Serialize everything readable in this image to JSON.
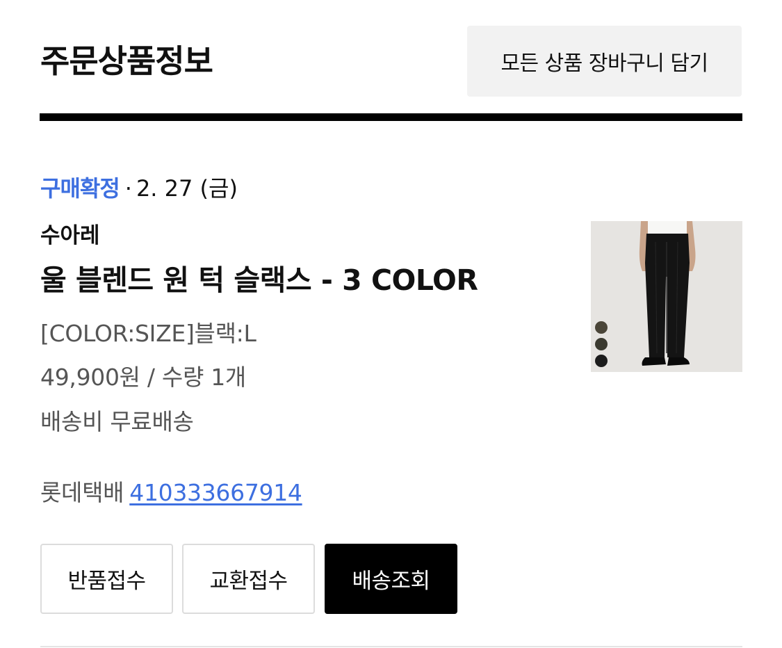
{
  "header": {
    "title": "주문상품정보",
    "add_all_to_cart_label": "모든 상품 장바구니 담기"
  },
  "order_item": {
    "status": "구매확정",
    "separator": "·",
    "date": "2. 27 (금)",
    "brand": "수아레",
    "product_name": "울 블렌드 원 턱 슬랙스 - 3 COLOR",
    "option": "[COLOR:SIZE]블랙:L",
    "price_quantity": "49,900원 / 수량 1개",
    "shipping_fee": "배송비 무료배송",
    "carrier": "롯데택배",
    "tracking_number": "410333667914",
    "thumbnail": {
      "icon": "product-photo-black-trousers",
      "color_swatches": [
        "#4a4538",
        "#3b3a30",
        "#1c1c1c"
      ]
    }
  },
  "actions": {
    "return_label": "반품접수",
    "exchange_label": "교환접수",
    "track_label": "배송조회"
  },
  "colors": {
    "accent_blue": "#3d6fe0",
    "primary_black": "#000000",
    "muted_text": "#555555"
  }
}
